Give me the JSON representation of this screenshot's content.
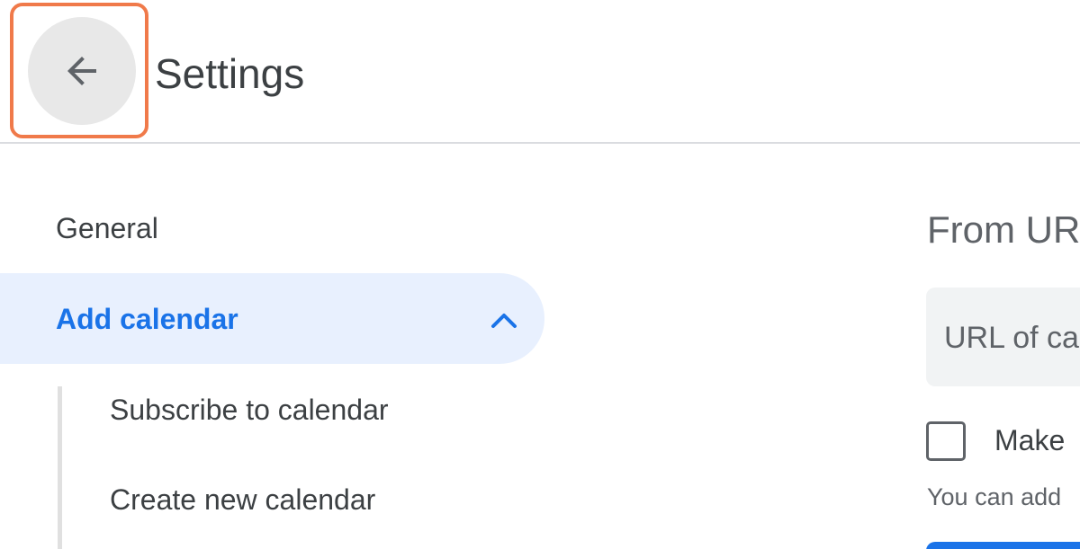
{
  "header": {
    "title": "Settings",
    "back_icon": "arrow-left-icon"
  },
  "sidebar": {
    "items": [
      {
        "label": "General"
      },
      {
        "label": "Add calendar",
        "expanded": true,
        "icon": "chevron-up-icon"
      }
    ],
    "subitems": [
      {
        "label": "Subscribe to calendar"
      },
      {
        "label": "Create new calendar"
      }
    ]
  },
  "main": {
    "heading": "From URL",
    "url_field": {
      "placeholder": "URL of calendar"
    },
    "checkbox": {
      "label": "Make",
      "checked": false
    },
    "helper_text": "You can add"
  },
  "colors": {
    "accent": "#1a73e8",
    "active_bg": "#e8f0fe",
    "highlight": "#f07a4a"
  }
}
